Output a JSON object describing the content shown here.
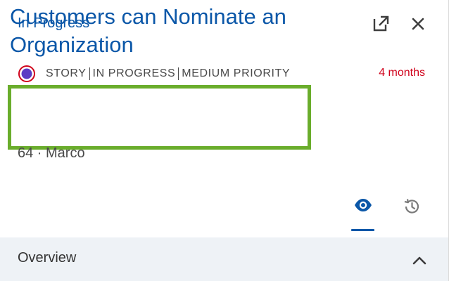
{
  "header": {
    "title": "In Progress",
    "open_icon": "open-in-new-icon",
    "close_icon": "close-icon"
  },
  "item": {
    "type_icon": "story-type-icon",
    "type": "STORY",
    "status": "IN PROGRESS",
    "priority": "MEDIUM PRIORITY",
    "age": "4 months",
    "title": "Customers can Nominate an Organization",
    "sub": "64 · Marco"
  },
  "tabs": [
    {
      "name": "watch",
      "icon": "eye-icon",
      "active": true
    },
    {
      "name": "history",
      "icon": "history-icon",
      "active": false
    }
  ],
  "overview": {
    "label": "Overview",
    "icon": "chevron-up-icon"
  },
  "colors": {
    "accent": "#0b57a8",
    "age": "#d0021b",
    "highlight": "#6aad2c",
    "section_bg": "#eef2f6",
    "type_icon_ring": "#d0021b",
    "type_icon_fill": "#5b3cc4"
  }
}
